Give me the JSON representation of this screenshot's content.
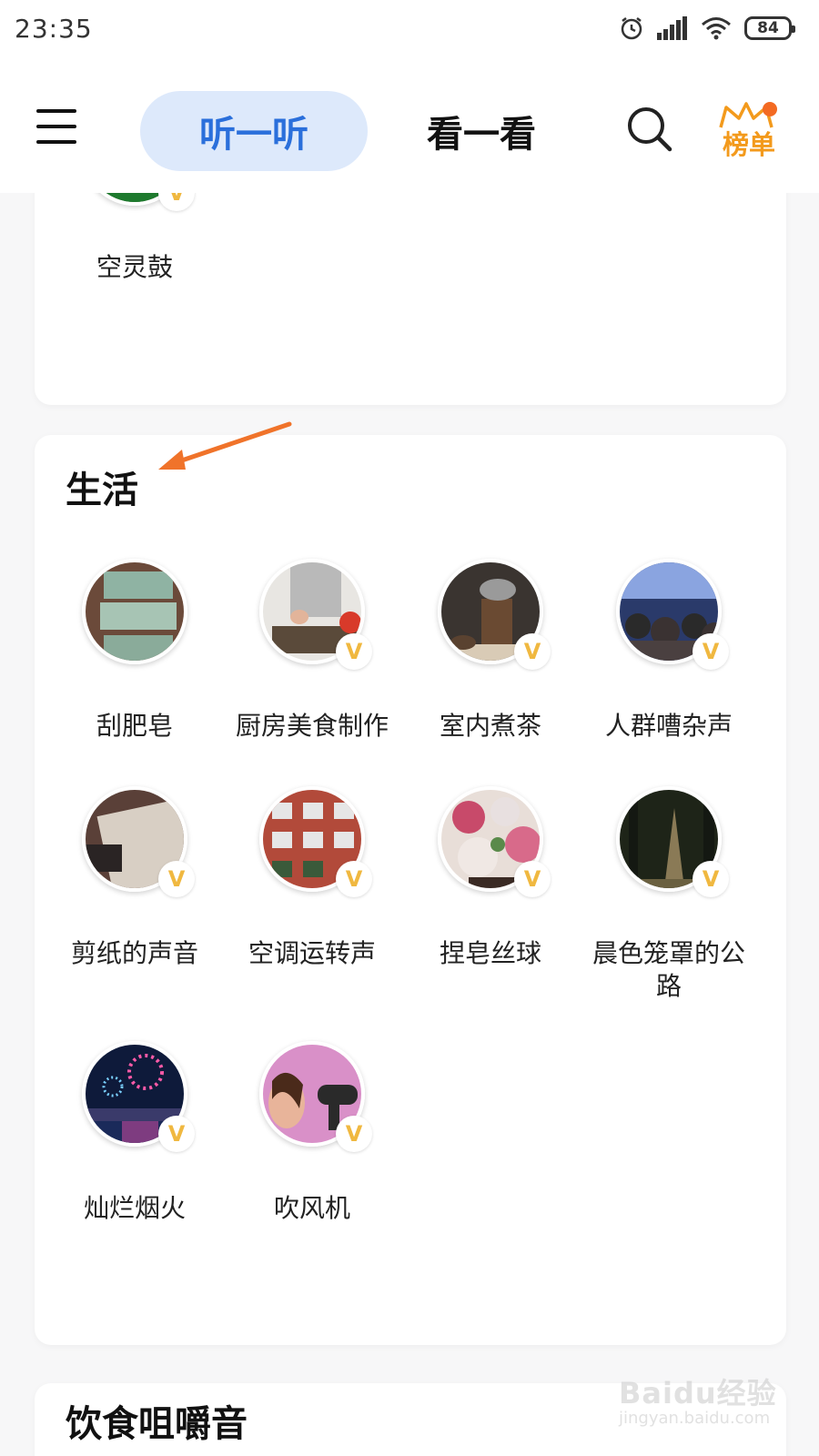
{
  "status_bar": {
    "time": "23:35",
    "battery": "84",
    "icons": [
      "alarm-icon",
      "signal-icon",
      "wifi-icon",
      "battery-icon"
    ]
  },
  "top_nav": {
    "menu_icon": "menu-icon",
    "tabs": [
      {
        "label": "听一听",
        "active": true
      },
      {
        "label": "看一看",
        "active": false
      }
    ],
    "search_icon": "search-icon",
    "rank_label": "榜单"
  },
  "sections": {
    "previous": {
      "items": [
        {
          "label": "空灵鼓",
          "vip": true
        }
      ]
    },
    "life": {
      "title": "生活",
      "items": [
        {
          "label": "刮肥皂",
          "vip": false
        },
        {
          "label": "厨房美食制作",
          "vip": true
        },
        {
          "label": "室内煮茶",
          "vip": true
        },
        {
          "label": "人群嘈杂声",
          "vip": true
        },
        {
          "label": "剪纸的声音",
          "vip": true
        },
        {
          "label": "空调运转声",
          "vip": true
        },
        {
          "label": "捏皂丝球",
          "vip": true
        },
        {
          "label": "晨色笼罩的公路",
          "vip": true
        },
        {
          "label": "灿烂烟火",
          "vip": true
        },
        {
          "label": "吹风机",
          "vip": true
        }
      ]
    },
    "food": {
      "title": "饮食咀嚼音"
    }
  },
  "vip_badge": "V",
  "watermark": {
    "main": "Baidu经验",
    "sub": "jingyan.baidu.com"
  },
  "colors": {
    "accent_blue": "#2a6fdb",
    "tab_bg": "#dde9fb",
    "rank_orange": "#f39a1c",
    "vip_gold": "#f0b840",
    "annotation_arrow": "#f0732a"
  }
}
